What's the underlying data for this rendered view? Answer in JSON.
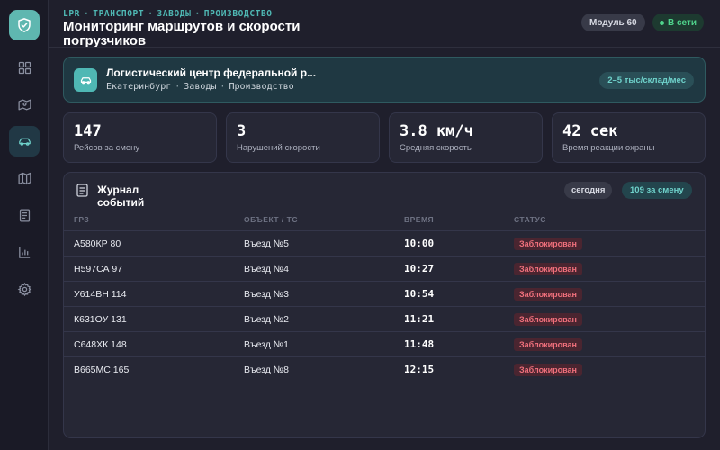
{
  "sidebar": {
    "logo_icon": "shield-check-icon",
    "items": [
      {
        "icon": "dashboard-grid-icon",
        "active": false
      },
      {
        "icon": "route-map-icon",
        "active": false
      },
      {
        "icon": "car-icon",
        "active": true
      },
      {
        "icon": "map-icon",
        "active": false
      },
      {
        "icon": "document-icon",
        "active": false
      },
      {
        "icon": "bar-chart-icon",
        "active": false
      },
      {
        "icon": "gear-icon",
        "active": false
      }
    ]
  },
  "header": {
    "breadcrumb": [
      "LPR",
      "ТРАНСПОРТ",
      "ЗАВОДЫ",
      "ПРОИЗВОДСТВО"
    ],
    "title": "Мониторинг маршрутов и скорости погрузчиков",
    "module_label": "Модуль 60",
    "status_label": "В сети"
  },
  "facility": {
    "name": "Логистический центр федеральной р...",
    "city": "Екатеринбург",
    "category": "Заводы",
    "sector": "Производство",
    "volume": "2–5 тыс/склад/мес"
  },
  "stats": [
    {
      "value": "147",
      "label": "Рейсов за смену"
    },
    {
      "value": "3",
      "label": "Нарушений скорости"
    },
    {
      "value": "3.8 км/ч",
      "label": "Средняя скорость"
    },
    {
      "value": "42 сек",
      "label": "Время реакции охраны"
    }
  ],
  "journal": {
    "title": "Журнал событий",
    "today_label": "сегодня",
    "count_label": "109 за смену",
    "columns": [
      "ГРЗ",
      "ОБЪЕКТ / ТС",
      "ВРЕМЯ",
      "СТАТУС"
    ],
    "rows": [
      {
        "plate": "А580КР 80",
        "object": "Въезд №5",
        "time": "10:00",
        "status": "Заблокирован"
      },
      {
        "plate": "Н597СА 97",
        "object": "Въезд №4",
        "time": "10:27",
        "status": "Заблокирован"
      },
      {
        "plate": "У614ВН 114",
        "object": "Въезд №3",
        "time": "10:54",
        "status": "Заблокирован"
      },
      {
        "plate": "К631ОУ 131",
        "object": "Въезд №2",
        "time": "11:21",
        "status": "Заблокирован"
      },
      {
        "plate": "С648ХК 148",
        "object": "Въезд №1",
        "time": "11:48",
        "status": "Заблокирован"
      },
      {
        "plate": "В665МС 165",
        "object": "Въезд №8",
        "time": "12:15",
        "status": "Заблокирован"
      }
    ]
  },
  "colors": {
    "accent": "#4fb8b4",
    "online": "#4fd48c",
    "blocked": "#f0707c",
    "background": "#1f1f2c",
    "card": "#262735"
  }
}
